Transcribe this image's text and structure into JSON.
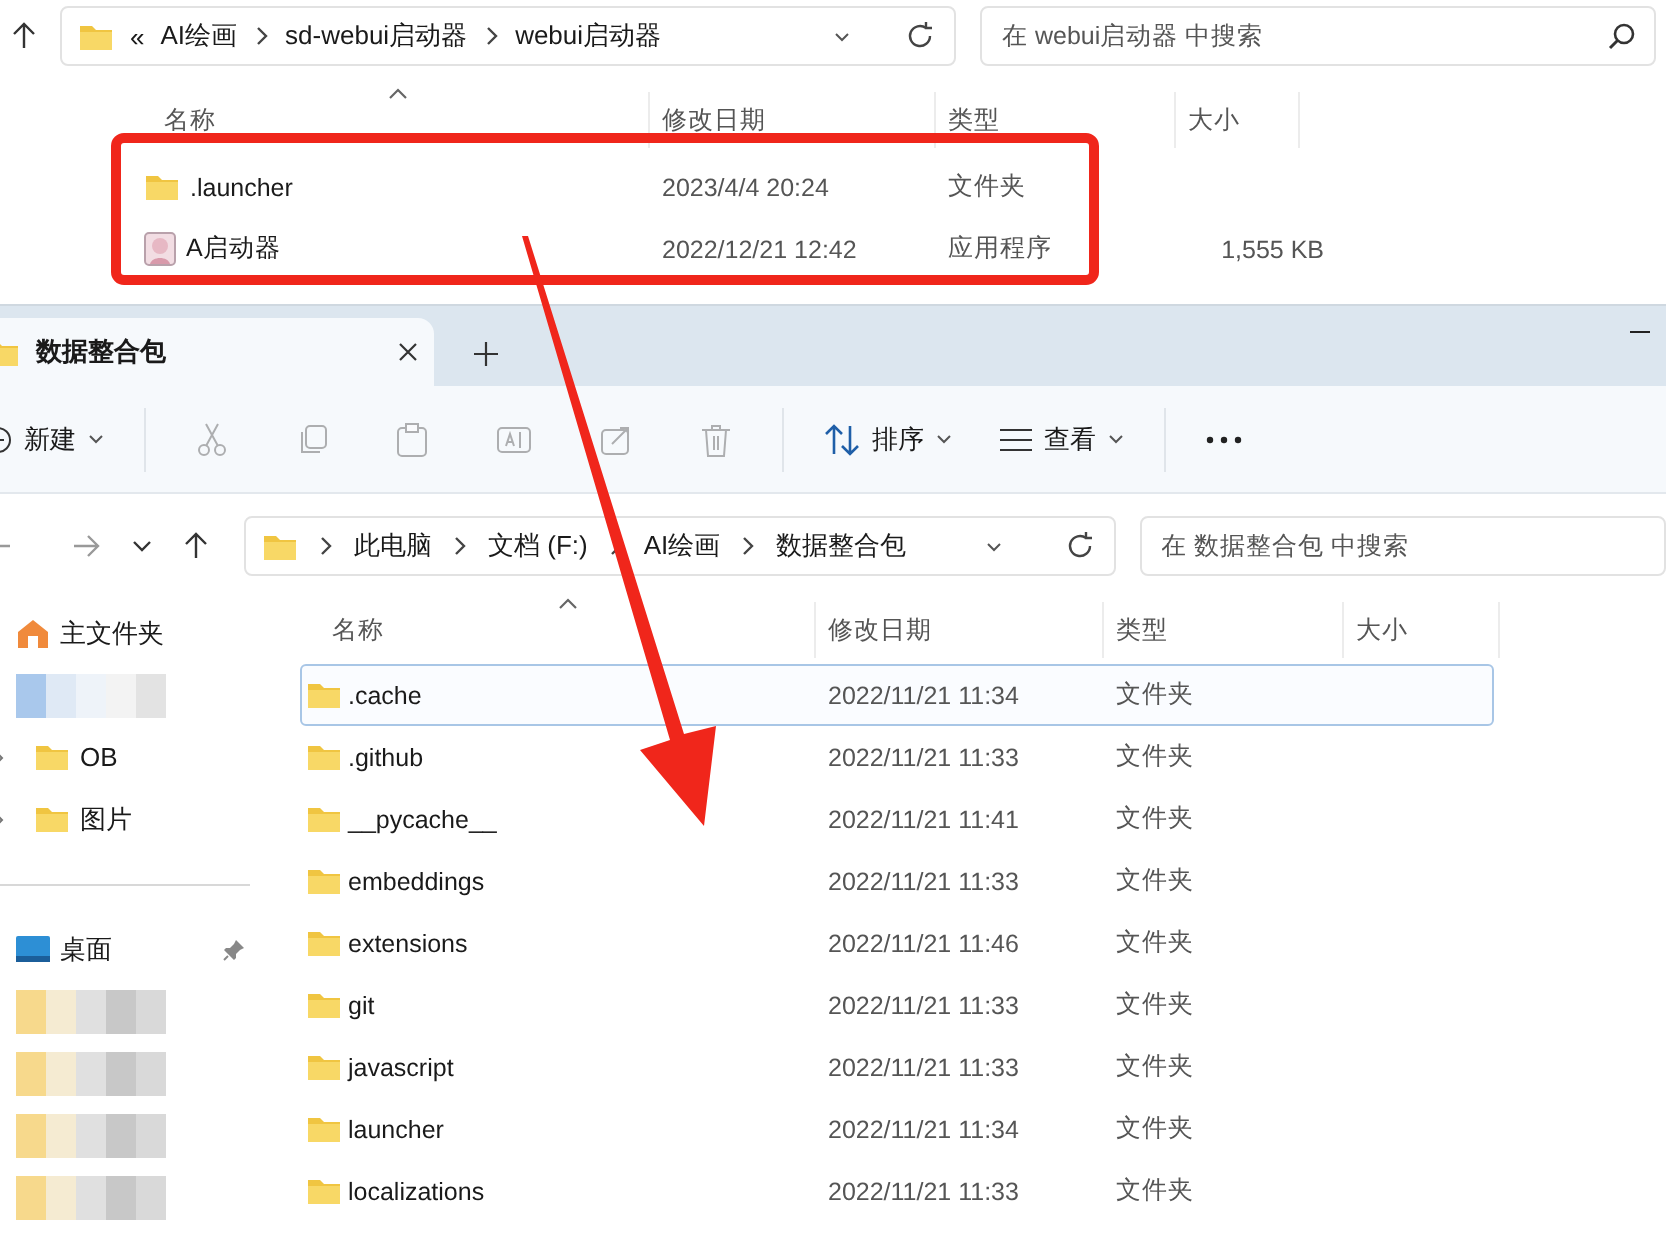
{
  "top_window": {
    "address": {
      "overflow": "«",
      "path": [
        "AI绘画",
        "sd-webui启动器",
        "webui启动器"
      ]
    },
    "search": {
      "placeholder": "在 webui启动器 中搜索"
    },
    "columns": [
      "名称",
      "修改日期",
      "类型",
      "大小"
    ],
    "rows": [
      {
        "kind": "folder",
        "name": ".launcher",
        "modified": "2023/4/4 20:24",
        "type": "文件夹"
      },
      {
        "kind": "app",
        "name": "A启动器",
        "modified": "2022/12/21 12:42",
        "type": "应用程序",
        "size": "1,555 KB"
      }
    ]
  },
  "window": {
    "tab": {
      "title": "数据整合包"
    },
    "toolbar": [
      {
        "kind": "new",
        "label": "新建",
        "disabled": false
      },
      {
        "kind": "cut",
        "disabled": true
      },
      {
        "kind": "copy",
        "disabled": true
      },
      {
        "kind": "paste",
        "disabled": true
      },
      {
        "kind": "rename",
        "disabled": true
      },
      {
        "kind": "share",
        "disabled": true
      },
      {
        "kind": "delete",
        "disabled": true
      },
      {
        "kind": "sort",
        "label": "排序",
        "disabled": false
      },
      {
        "kind": "view",
        "label": "查看",
        "disabled": false
      },
      {
        "kind": "more",
        "disabled": false
      }
    ],
    "address": {
      "path": [
        "此电脑",
        "文档 (F:)",
        "AI绘画",
        "数据整合包"
      ]
    },
    "search": {
      "placeholder": "在 数据整合包 中搜索"
    },
    "sidebar": [
      {
        "kind": "home",
        "label": "主文件夹"
      },
      {
        "kind": "blurred"
      },
      {
        "kind": "folder",
        "label": "OB",
        "expanded": false
      },
      {
        "kind": "folder",
        "label": "图片",
        "expanded": false
      },
      {
        "kind": "separator"
      },
      {
        "kind": "desktop",
        "label": "桌面",
        "pinned": true
      },
      {
        "kind": "blurred"
      },
      {
        "kind": "blurred"
      },
      {
        "kind": "blurred"
      },
      {
        "kind": "blurred"
      }
    ],
    "columns": [
      "名称",
      "修改日期",
      "类型",
      "大小"
    ],
    "rows": [
      {
        "name": ".cache",
        "modified": "2022/11/21 11:34",
        "type": "文件夹",
        "selected": true
      },
      {
        "name": ".github",
        "modified": "2022/11/21 11:33",
        "type": "文件夹",
        "selected": false
      },
      {
        "name": "__pycache__",
        "modified": "2022/11/21 11:41",
        "type": "文件夹",
        "selected": false
      },
      {
        "name": "embeddings",
        "modified": "2022/11/21 11:33",
        "type": "文件夹",
        "selected": false
      },
      {
        "name": "extensions",
        "modified": "2022/11/21 11:46",
        "type": "文件夹",
        "selected": false
      },
      {
        "name": "git",
        "modified": "2022/11/21 11:33",
        "type": "文件夹",
        "selected": false
      },
      {
        "name": "javascript",
        "modified": "2022/11/21 11:33",
        "type": "文件夹",
        "selected": false
      },
      {
        "name": "launcher",
        "modified": "2022/11/21 11:34",
        "type": "文件夹",
        "selected": false
      },
      {
        "name": "localizations",
        "modified": "2022/11/21 11:33",
        "type": "文件夹",
        "selected": false
      }
    ]
  },
  "annotations": {
    "highlight_box": true,
    "arrow": true
  }
}
